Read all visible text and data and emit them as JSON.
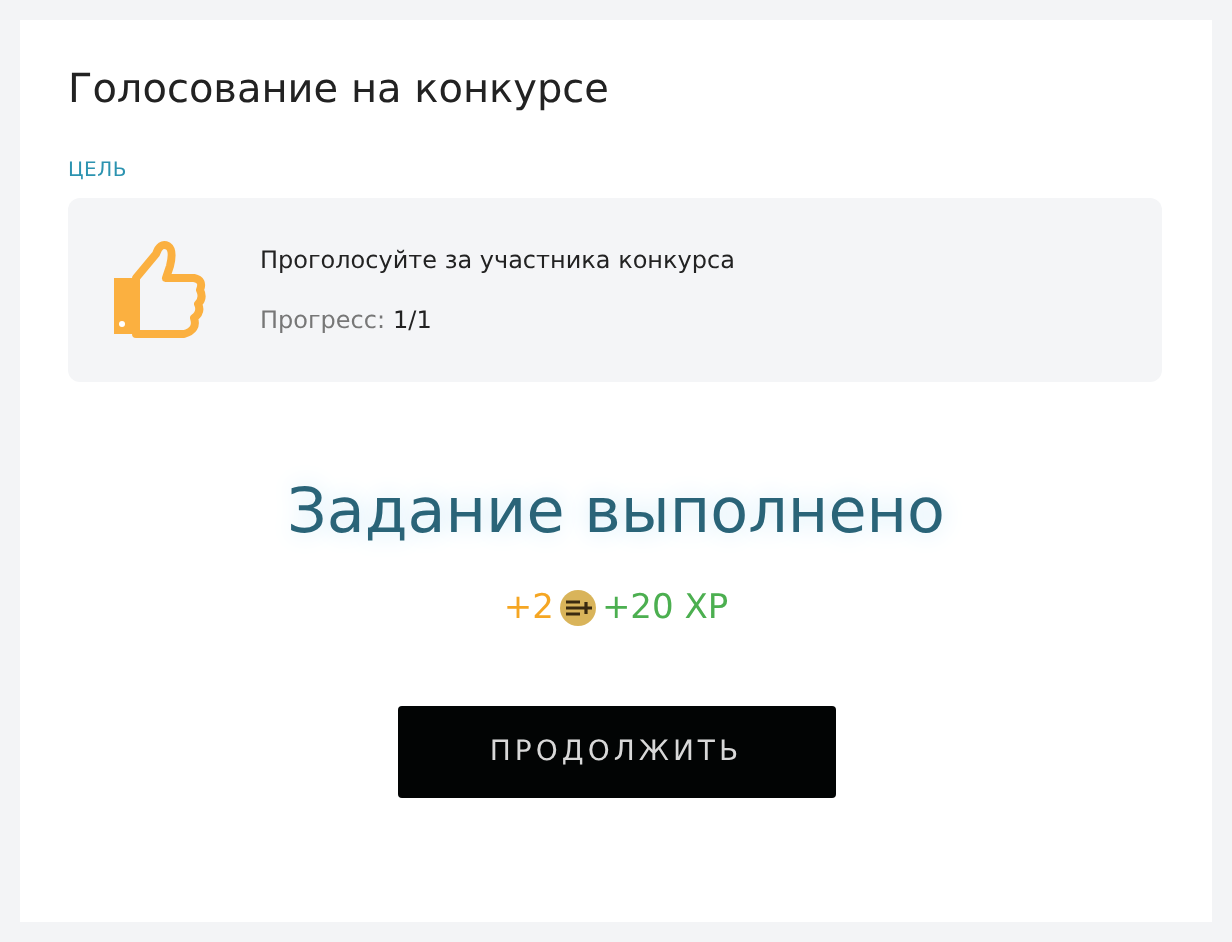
{
  "title": "Голосование на конкурсе",
  "goal": {
    "label": "ЦЕЛЬ",
    "task": "Проголосуйте за участника конкурса",
    "progress_label": "Прогресс:",
    "progress_value": "1/1"
  },
  "result": {
    "heading": "Задание выполнено",
    "rewards": [
      {
        "kind": "coins",
        "text": "+2"
      },
      {
        "kind": "xp",
        "text": "+20 XP"
      }
    ]
  },
  "button": "ПРОДОЛЖИТЬ"
}
